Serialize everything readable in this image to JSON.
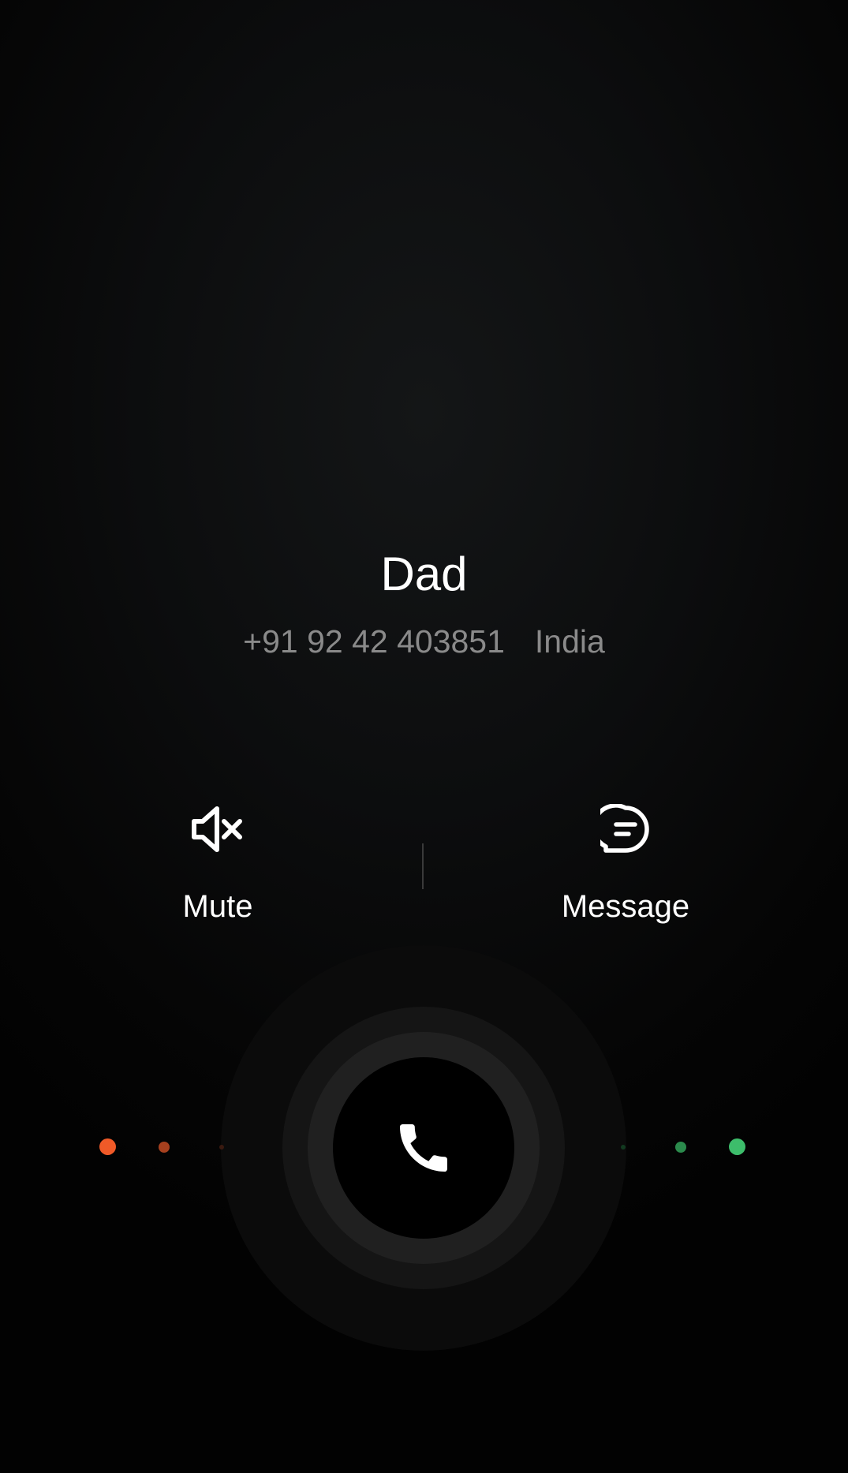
{
  "incoming_call": {
    "caller_name": "Dad",
    "phone_number": "+91 92 42 403851",
    "location": "India"
  },
  "actions": {
    "mute": {
      "label": "Mute",
      "icon": "speaker-muted-icon"
    },
    "message": {
      "label": "Message",
      "icon": "chat-bubble-icon"
    }
  },
  "answer_control": {
    "icon": "phone-handset-icon",
    "decline_hint_color": "#f05a28",
    "accept_hint_color": "#3dbd6b"
  },
  "colors": {
    "background": "#0c0d0e",
    "primary_text": "#ffffff",
    "secondary_text": "#8a8a8a"
  }
}
